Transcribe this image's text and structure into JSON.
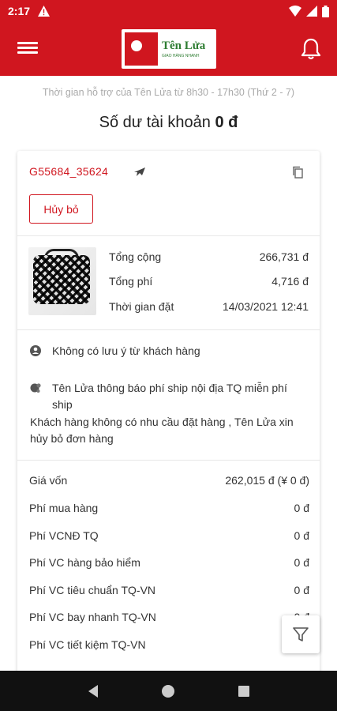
{
  "status_bar": {
    "time": "2:17"
  },
  "header": {
    "logo_brand": "Tên Lửa",
    "logo_tagline": "GIAO HÀNG NHANH"
  },
  "support_text": "Thời gian hỗ trợ của Tên Lửa từ 8h30 - 17h30 (Thứ 2 - 7)",
  "balance": {
    "label": "Số dư tài khoản",
    "value": "0 đ"
  },
  "order": {
    "code": "G55684_35624",
    "cancel_label": "Hủy bỏ",
    "summary": [
      {
        "label": "Tổng cộng",
        "value": "266,731 đ"
      },
      {
        "label": "Tổng phí",
        "value": "4,716 đ"
      },
      {
        "label": "Thời gian đặt",
        "value": "14/03/2021 12:41"
      }
    ],
    "customer_note": "Không có lưu ý từ khách hàng",
    "system_note": {
      "line1": "Tên Lửa thông báo phí ship nội địa TQ miễn phí ship",
      "line2": "Khách hàng không có nhu cầu đặt hàng , Tên Lửa xin hủy bỏ đơn hàng"
    },
    "fees": [
      {
        "label": "Giá vốn",
        "value": "262,015 đ (¥ 0 đ)"
      },
      {
        "label": "Phí mua hàng",
        "value": "0 đ"
      },
      {
        "label": "Phí VCNĐ TQ",
        "value": "0 đ"
      },
      {
        "label": "Phí VC hàng bảo hiểm",
        "value": "0 đ"
      },
      {
        "label": "Phí VC tiêu chuẩn TQ-VN",
        "value": "0 đ"
      },
      {
        "label": "Phí VC bay nhanh TQ-VN",
        "value": "0 đ"
      },
      {
        "label": "Phí VC tiết kiệm TQ-VN",
        "value": ""
      }
    ]
  },
  "colors": {
    "primary": "#d0161f",
    "nav_bar": "#111111"
  },
  "icons": [
    "menu-icon",
    "bell-icon",
    "plane-icon",
    "copy-icon",
    "user-icon",
    "notification-icon",
    "filter-icon",
    "back-icon",
    "home-icon",
    "recents-icon"
  ]
}
